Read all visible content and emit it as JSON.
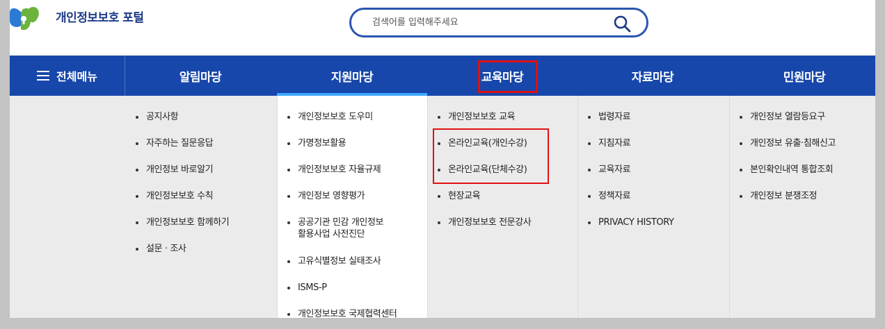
{
  "site": {
    "name": "개인정보보호 포털"
  },
  "search": {
    "placeholder": "검색어를 입력해주세요"
  },
  "nav": {
    "all_menu": "전체메뉴",
    "items": [
      "알림마당",
      "지원마당",
      "교육마당",
      "자료마당",
      "민원마당"
    ]
  },
  "menu": {
    "col1": [
      "공지사항",
      "자주하는 질문응답",
      "개인정보 바로알기",
      "개인정보보호 수칙",
      "개인정보보호 함께하기",
      "설문 · 조사"
    ],
    "col2": [
      "개인정보보호 도우미",
      "가명정보활용",
      "개인정보보호 자율규제",
      "개인정보 영향평가",
      "공공기관 민감 개인정보",
      "활용사업 사전진단",
      "고유식별정보 실태조사",
      "ISMS-P",
      "개인정보보호 국제협력센터"
    ],
    "col3": [
      "개인정보보호 교육",
      "온라인교육(개인수강)",
      "온라인교육(단체수강)",
      "현장교육",
      "개인정보보호 전문강사"
    ],
    "col4": [
      "법령자료",
      "지침자료",
      "교육자료",
      "정책자료",
      "PRIVACY HISTORY"
    ],
    "col5": [
      "개인정보 열람등요구",
      "개인정보 유출·침해신고",
      "본인확인내역 통합조회",
      "개인정보 분쟁조정"
    ]
  },
  "colors": {
    "nav_bg": "#1747aa",
    "active_underline": "#3fa9ff",
    "highlight_box": "#e01010",
    "logo_green": "#6cb33e",
    "logo_blue": "#2b7bd6"
  }
}
